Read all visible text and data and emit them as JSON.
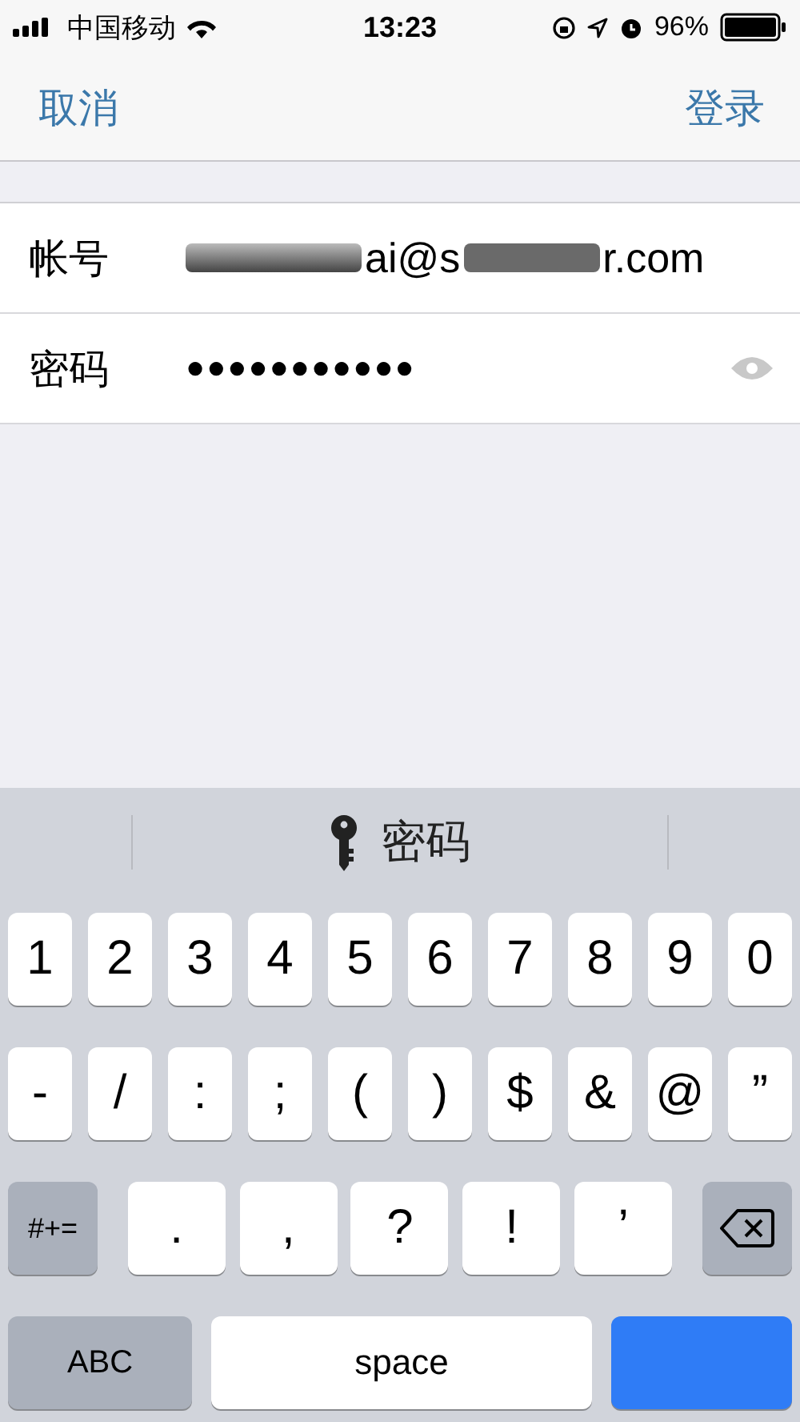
{
  "status_bar": {
    "carrier": "中国移动",
    "time": "13:23",
    "battery": "96%"
  },
  "nav": {
    "left": "取消",
    "right": "登录"
  },
  "form": [
    {
      "kind": "account",
      "label": "帐号",
      "value_start": "ai@s",
      "value_end": "r.com"
    },
    {
      "kind": "password",
      "label": "密码",
      "value": "●●●●●●●●●●●"
    }
  ],
  "keyboard": {
    "suggestion": "密码",
    "rows": [
      {
        "keys": [
          {
            "kind": "char",
            "label": "1"
          },
          {
            "kind": "char",
            "label": "2"
          },
          {
            "kind": "char",
            "label": "3"
          },
          {
            "kind": "char",
            "label": "4"
          },
          {
            "kind": "char",
            "label": "5"
          },
          {
            "kind": "char",
            "label": "6"
          },
          {
            "kind": "char",
            "label": "7"
          },
          {
            "kind": "char",
            "label": "8"
          },
          {
            "kind": "char",
            "label": "9"
          },
          {
            "kind": "char",
            "label": "0"
          }
        ]
      },
      {
        "keys": [
          {
            "kind": "char",
            "label": "-"
          },
          {
            "kind": "char",
            "label": "/"
          },
          {
            "kind": "char",
            "label": ":"
          },
          {
            "kind": "char",
            "label": ";"
          },
          {
            "kind": "char",
            "label": "("
          },
          {
            "kind": "char",
            "label": ")"
          },
          {
            "kind": "char",
            "label": "$"
          },
          {
            "kind": "char",
            "label": "&"
          },
          {
            "kind": "char",
            "label": "@"
          },
          {
            "kind": "char",
            "label": "”"
          }
        ]
      },
      {
        "keys": [
          {
            "kind": "mod",
            "label": "#+="
          },
          {
            "kind": "wide",
            "label": "."
          },
          {
            "kind": "wide",
            "label": ","
          },
          {
            "kind": "wide",
            "label": "?"
          },
          {
            "kind": "wide",
            "label": "!"
          },
          {
            "kind": "wide",
            "label": "’"
          },
          {
            "kind": "delete"
          }
        ]
      },
      {
        "keys": [
          {
            "kind": "abc",
            "label": "ABC"
          },
          {
            "kind": "space",
            "label": "space"
          },
          {
            "kind": "return"
          }
        ]
      }
    ]
  }
}
